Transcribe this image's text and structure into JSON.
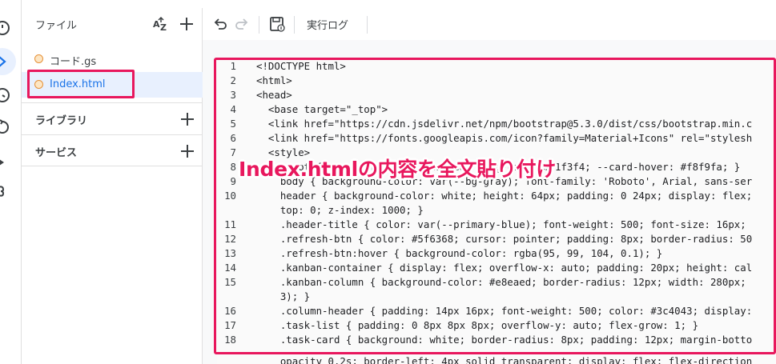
{
  "files_panel": {
    "title": "ファイル",
    "files": [
      {
        "name": "コード.gs"
      },
      {
        "name": "Index.html"
      }
    ],
    "sections": [
      {
        "label": "ライブラリ"
      },
      {
        "label": "サービス"
      }
    ]
  },
  "toolbar": {
    "log_label": "実行ログ"
  },
  "editor": {
    "lines": [
      {
        "n": "1",
        "text": "<!DOCTYPE html>"
      },
      {
        "n": "2",
        "text": "<html>"
      },
      {
        "n": "3",
        "text": "<head>"
      },
      {
        "n": "4",
        "text": "  <base target=\"_top\">"
      },
      {
        "n": "5",
        "text": "  <link href=\"https://cdn.jsdelivr.net/npm/bootstrap@5.3.0/dist/css/bootstrap.min.c"
      },
      {
        "n": "6",
        "text": "  <link href=\"https://fonts.googleapis.com/icon?family=Material+Icons\" rel=\"stylesh"
      },
      {
        "n": "7",
        "text": "  <style>"
      },
      {
        "n": "8",
        "text": "    :root { --primary-blue: #1a73e8; --bg-gray: #f1f3f4; --card-hover: #f8f9fa; }"
      },
      {
        "n": "9",
        "text": "    body { background-color: var(--bg-gray); font-family: 'Roboto', Arial, sans-ser"
      },
      {
        "n": "10",
        "text": "    header { background-color: white; height: 64px; padding: 0 24px; display: flex;",
        "wrap": "    top: 0; z-index: 1000; }"
      },
      {
        "n": "11",
        "text": "    .header-title { color: var(--primary-blue); font-weight: 500; font-size: 16px;"
      },
      {
        "n": "12",
        "text": "    .refresh-btn { color: #5f6368; cursor: pointer; padding: 8px; border-radius: 50"
      },
      {
        "n": "13",
        "text": "    .refresh-btn:hover { background-color: rgba(95, 99, 104, 0.1); }"
      },
      {
        "n": "14",
        "text": "    .kanban-container { display: flex; overflow-x: auto; padding: 20px; height: cal"
      },
      {
        "n": "15",
        "text": "    .kanban-column { background-color: #e8eaed; border-radius: 12px; width: 280px;",
        "wrap": "    3); }"
      },
      {
        "n": "16",
        "text": "    .column-header { padding: 14px 16px; font-weight: 500; color: #3c4043; display:"
      },
      {
        "n": "17",
        "text": "    .task-list { padding: 0 8px 8px 8px; overflow-y: auto; flex-grow: 1; }"
      },
      {
        "n": "18",
        "text": "    .task-card { background: white; border-radius: 8px; padding: 12px; margin-botto"
      }
    ],
    "tail_text": "    opacity 0.2s; border-left: 4px solid transparent; display: flex; flex-direction"
  },
  "annotation": {
    "text": "Index.htmlの内容を全文貼り付け"
  },
  "colors": {
    "highlight": "#e8175d",
    "accent": "#1a73e8",
    "file_dot": "#e69138"
  }
}
